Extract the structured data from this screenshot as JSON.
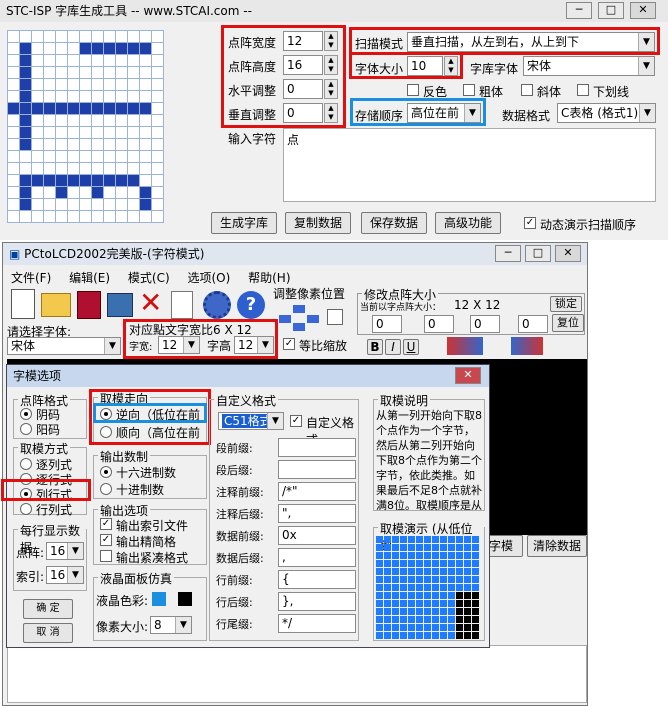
{
  "stc": {
    "title": "STC-ISP 字库生成工具 -- www.STCAI.com --",
    "dot_width_label": "点阵宽度",
    "dot_width": "12",
    "dot_height_label": "点阵高度",
    "dot_height": "16",
    "h_adjust_label": "水平调整",
    "h_adjust": "0",
    "v_adjust_label": "垂直调整",
    "v_adjust": "0",
    "scan_mode_label": "扫描模式",
    "scan_mode": "垂直扫描，从左到右，从上到下",
    "font_size_label": "字体大小",
    "font_size": "10",
    "font_label": "字库字体",
    "font": "宋体",
    "reverse_label": "反色",
    "bold_label": "粗体",
    "italic_label": "斜体",
    "underline_label": "下划线",
    "store_order_label": "存储顺序",
    "store_order": "高位在前",
    "data_format_label": "数据格式",
    "data_format": "C表格 (格式1)",
    "input_label": "输入字符",
    "input_value": "点",
    "btn_generate": "生成字库",
    "btn_copy": "复制数据",
    "btn_save": "保存数据",
    "btn_advanced": "高级功能",
    "dynamic_label": "动态演示扫描顺序"
  },
  "pcto": {
    "title": "PCtoLCD2002完美版-(字符模式)",
    "menu": [
      "文件(F)",
      "编辑(E)",
      "模式(C)",
      "选项(O)",
      "帮助(H)"
    ],
    "pixel_pos_label": "调整像素位置",
    "modify_size_label": "修改点阵大小",
    "current_size_label": "当前以字点阵大小：",
    "current_size": "12 X 12",
    "lock_label": "锁定",
    "restore_label": "复位",
    "spin_values": [
      "0",
      "0",
      "0",
      "0"
    ],
    "font_select_label": "请选择字体:",
    "font": "宋体",
    "size_note": "对应點文字宽比6 X 12",
    "char_width_label": "字宽:",
    "char_width": "12",
    "char_height_label": "字高",
    "char_height": "12",
    "equal_scale_label": "等比缩放",
    "fmt_b": "B",
    "fmt_i": "I",
    "fmt_u": "U",
    "btn_char_mode": "字模",
    "btn_clear": "清除数据"
  },
  "dialog": {
    "title": "字模选项",
    "dot_format_label": "点阵格式",
    "dot_format_options": [
      "阴码",
      "阳码"
    ],
    "mode_label": "取模方式",
    "mode_options": [
      "逐列式",
      "逐行式",
      "列行式",
      "行列式"
    ],
    "direction_label": "取模走向",
    "direction_options": [
      "逆向（低位在前",
      "顺向（高位在前"
    ],
    "output_base_label": "输出数制",
    "output_base_options": [
      "十六进制数",
      "十进制数"
    ],
    "output_opts_label": "输出选项",
    "output_opts": [
      "输出索引文件",
      "输出精简格",
      "输出紧凑格式"
    ],
    "per_line_label": "每行显示数据",
    "dot_array_label": "点阵:",
    "dot_array": "16",
    "index_label": "索引:",
    "index": "16",
    "lcd_sim_label": "液晶面板仿真",
    "lcd_color_label": "液晶色彩:",
    "pixel_size_label": "像素大小:",
    "pixel_size": "8",
    "ok_label": "确  定",
    "cancel_label": "取  消",
    "custom_label": "自定义格式",
    "custom_select": "C51格式",
    "custom_check_label": "自定义格式",
    "fields": [
      {
        "label": "段前缀:",
        "value": ""
      },
      {
        "label": "段后缀:",
        "value": ""
      },
      {
        "label": "注释前缀:",
        "value": "/*\""
      },
      {
        "label": "注释后缀:",
        "value": "\","
      },
      {
        "label": "数据前缀:",
        "value": "0x"
      },
      {
        "label": "数据后缀:",
        "value": ","
      },
      {
        "label": "行前缀:",
        "value": "{"
      },
      {
        "label": "行后缀:",
        "value": "},"
      },
      {
        "label": "行尾缀:",
        "value": "*/"
      }
    ],
    "explain_label": "取模说明",
    "explain_text": "从第一列开始向下取8个点作为一个字节，然后从第二列开始向下取8个点作为第二个字节，依此类推。如果最后不足8个点就补满8位。取模顺序是从低到",
    "demo_label": "取模演示 (从低位到"
  },
  "colors": {
    "accent": "#1a8fe0",
    "highlight": "#e01010",
    "grid_on": "#1f3fa8",
    "demo_blue": "#1f7bff"
  }
}
